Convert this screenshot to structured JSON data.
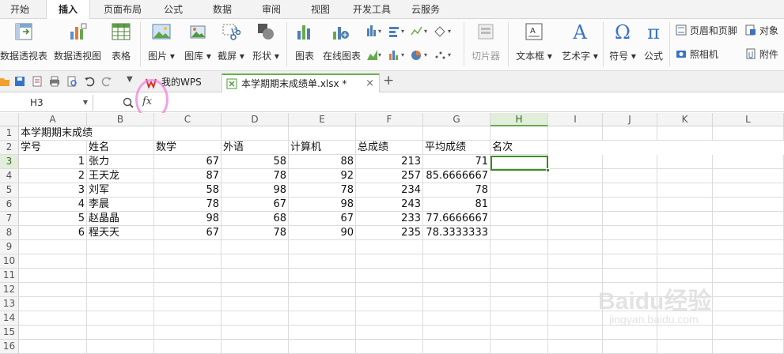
{
  "menu": {
    "tabs": [
      "开始",
      "插入",
      "页面布局",
      "公式",
      "数据",
      "审阅",
      "视图",
      "开发工具",
      "云服务"
    ],
    "active": "插入"
  },
  "ribbon": {
    "pivot_table": "数据透视表",
    "pivot_chart": "数据透视图",
    "table": "表格",
    "picture": "图片",
    "gallery": "图库",
    "screenshot": "截屏",
    "shapes": "形状",
    "chart": "图表",
    "online_chart": "在线图表",
    "slicer": "切片器",
    "textbox": "文本框",
    "wordart": "艺术字",
    "symbol": "符号",
    "formula": "公式",
    "header_footer": "页眉和页脚",
    "object": "对象",
    "camera": "照相机",
    "attachment": "附件",
    "omega_glyph": "Ω",
    "pi_glyph": "π",
    "wordart_glyph": "A"
  },
  "docbar": {
    "wps_tab": "我的WPS",
    "file_tab": "本学期期末成绩单.xlsx *",
    "close": "×",
    "add": "+"
  },
  "formula_bar": {
    "name_box": "H3",
    "fx": "fx",
    "value": ""
  },
  "sheet": {
    "columns": [
      "A",
      "B",
      "C",
      "D",
      "E",
      "F",
      "G",
      "H",
      "I",
      "J",
      "K",
      "L"
    ],
    "selected_column": "H",
    "rows": [
      "1",
      "2",
      "3",
      "4",
      "5",
      "6",
      "7",
      "8",
      "9",
      "10",
      "11",
      "12",
      "13",
      "14",
      "15",
      "16"
    ],
    "selected_row": "3",
    "title": "本学期期末成绩",
    "headers": [
      "学号",
      "姓名",
      "数学",
      "外语",
      "计算机",
      "总成绩",
      "平均成绩",
      "名次"
    ],
    "data": [
      [
        "1",
        "张力",
        "67",
        "58",
        "88",
        "213",
        "71"
      ],
      [
        "2",
        "王天龙",
        "87",
        "78",
        "92",
        "257",
        "85.6666667"
      ],
      [
        "3",
        "刘军",
        "58",
        "98",
        "78",
        "234",
        "78"
      ],
      [
        "4",
        "李晨",
        "78",
        "67",
        "98",
        "243",
        "81"
      ],
      [
        "5",
        "赵晶晶",
        "98",
        "68",
        "67",
        "233",
        "77.6666667"
      ],
      [
        "6",
        "程天天",
        "67",
        "78",
        "90",
        "235",
        "78.3333333"
      ]
    ]
  },
  "watermark": {
    "brand": "Baidu经验",
    "url": "jingyan.baidu.com"
  },
  "colors": {
    "accent": "#3d8a29",
    "selection_header": "#e2eedb",
    "annotation": "#f07ad8"
  }
}
